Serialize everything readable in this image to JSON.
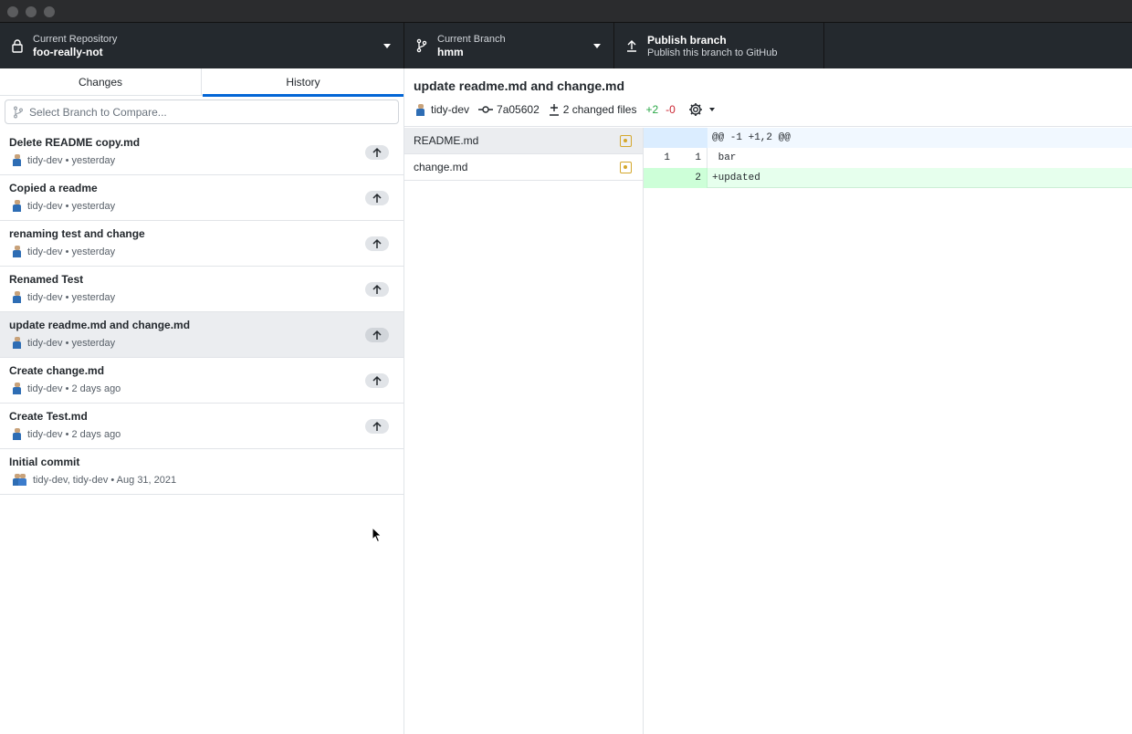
{
  "toolbar": {
    "repository": {
      "label": "Current Repository",
      "value": "foo-really-not"
    },
    "branch": {
      "label": "Current Branch",
      "value": "hmm"
    },
    "publish": {
      "title": "Publish branch",
      "subtitle": "Publish this branch to GitHub"
    }
  },
  "tabs": {
    "changes": "Changes",
    "history": "History",
    "active": "History"
  },
  "compare": {
    "placeholder": "Select Branch to Compare..."
  },
  "commits": [
    {
      "summary": "Delete README copy.md",
      "meta": "tidy-dev • yesterday",
      "unpushed": true
    },
    {
      "summary": "Copied a readme",
      "meta": "tidy-dev • yesterday",
      "unpushed": true
    },
    {
      "summary": "renaming test and change",
      "meta": "tidy-dev • yesterday",
      "unpushed": true
    },
    {
      "summary": "Renamed Test",
      "meta": "tidy-dev • yesterday",
      "unpushed": true
    },
    {
      "summary": "update readme.md and change.md",
      "meta": "tidy-dev • yesterday",
      "unpushed": true,
      "selected": true
    },
    {
      "summary": "Create change.md",
      "meta": "tidy-dev • 2 days ago",
      "unpushed": true
    },
    {
      "summary": "Create Test.md",
      "meta": "tidy-dev • 2 days ago",
      "unpushed": true
    },
    {
      "summary": "Initial commit",
      "meta": "tidy-dev, tidy-dev • Aug 31, 2021",
      "unpushed": false
    }
  ],
  "commit_detail": {
    "title": "update readme.md and change.md",
    "author": "tidy-dev",
    "sha": "7a05602",
    "changed_files": "2 changed files",
    "additions": "+2",
    "deletions": "-0"
  },
  "files": [
    {
      "name": "README.md",
      "status": "modified",
      "selected": true
    },
    {
      "name": "change.md",
      "status": "modified",
      "selected": false
    }
  ],
  "diff": {
    "hunk": "@@ -1 +1,2 @@",
    "lines": [
      {
        "old": "1",
        "new": "1",
        "text": " bar",
        "type": "context"
      },
      {
        "old": "",
        "new": "2",
        "text": "+updated",
        "type": "add"
      }
    ]
  },
  "colors": {
    "toolbar_bg": "#24292e",
    "accent": "#0366d6",
    "added": "#28a745",
    "deleted": "#cb2431",
    "modified": "#d4a72c"
  }
}
